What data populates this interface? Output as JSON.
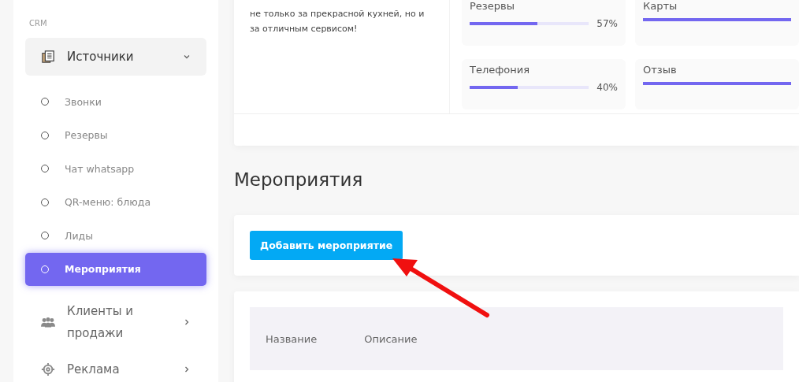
{
  "sidebar": {
    "section_label": "CRM",
    "groups": [
      {
        "label": "Источники",
        "expanded": true,
        "children": [
          {
            "label": "Звонки",
            "selected": false
          },
          {
            "label": "Резервы",
            "selected": false
          },
          {
            "label": "Чат whatsapp",
            "selected": false
          },
          {
            "label": "QR-меню: блюда",
            "selected": false
          },
          {
            "label": "Лиды",
            "selected": false
          },
          {
            "label": "Мероприятия",
            "selected": true
          }
        ]
      },
      {
        "label": "Клиенты и продажи",
        "expanded": false
      },
      {
        "label": "Реклама",
        "expanded": false
      }
    ]
  },
  "summary_card": {
    "text": "не только за прекрасной кухней, но и за отличным сервисом!",
    "metrics": [
      {
        "label": "Резервы",
        "level": 0.57,
        "reading": "57%"
      },
      {
        "label": "Карты",
        "level": 1
      },
      {
        "label": "Телефония",
        "level": 0.4,
        "reading": "40%"
      },
      {
        "label": "Отзыв",
        "level": 1
      }
    ]
  },
  "page_title": "Мероприятия",
  "add_button": "Добавить мероприятие",
  "table": {
    "columns": [
      "Название",
      "Описание"
    ]
  }
}
